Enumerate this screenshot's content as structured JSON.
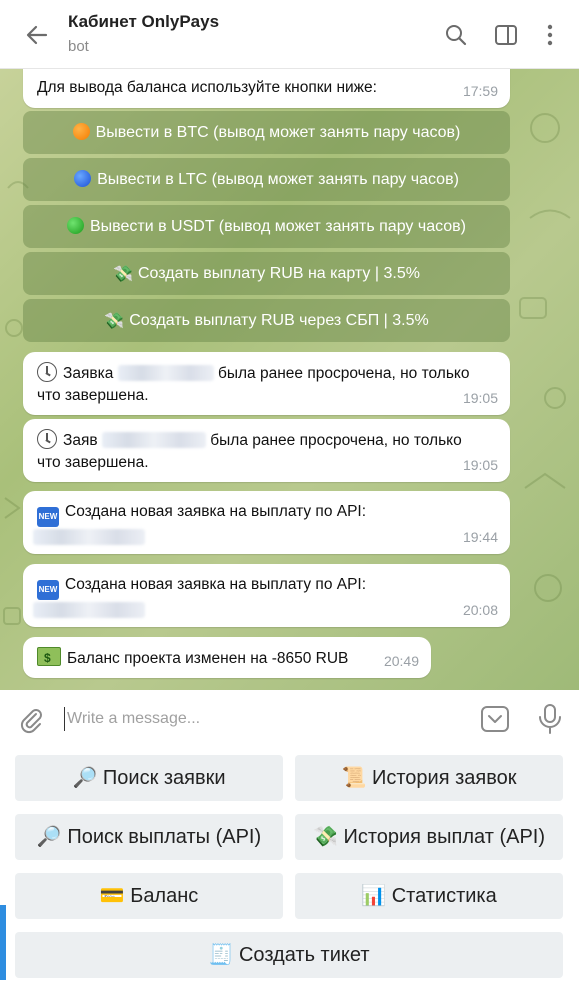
{
  "header": {
    "title": "Кабинет OnlyPays",
    "subtitle": "bot"
  },
  "chat": {
    "intro": {
      "text": "Для вывода баланса используйте кнопки ниже:",
      "time": "17:59"
    },
    "inline_buttons": [
      {
        "icon": "orange-circle",
        "label": "Вывести в BTC  (вывод может занять пару часов)"
      },
      {
        "icon": "blue-circle",
        "label": "Вывести в LTC  (вывод может занять пару часов)"
      },
      {
        "icon": "green-circle",
        "label": "Вывести в USDT  (вывод может занять пару часов)"
      },
      {
        "icon": "money-wings",
        "label": "Создать выплату RUB на карту | 3.5%"
      },
      {
        "icon": "money-wings",
        "label": "Создать выплату RUB через СБП | 3.5%"
      }
    ],
    "messages": [
      {
        "icon": "clock",
        "pre": "Заявка",
        "post": "была ранее просрочена, но только",
        "line2": "что завершена.",
        "time": "19:05"
      },
      {
        "icon": "clock",
        "pre": "Заяв",
        "post": "была ранее просрочена, но только",
        "line2": "что завершена.",
        "time": "19:05"
      },
      {
        "icon": "new-badge",
        "text": "Создана новая заявка на выплату по API:",
        "time": "19:44"
      },
      {
        "icon": "new-badge",
        "text": "Создана новая заявка на выплату по API:",
        "time": "20:08"
      },
      {
        "icon": "money-bag",
        "text": "Баланс проекта изменен на ",
        "amount": "-8650 RUB",
        "time": "20:49"
      }
    ]
  },
  "composer": {
    "placeholder": "Write a message..."
  },
  "keyboard": [
    {
      "icon": "🔎",
      "label": "Поиск заявки"
    },
    {
      "icon": "📜",
      "label": "История заявок"
    },
    {
      "icon": "🔎",
      "label": "Поиск выплаты (API)"
    },
    {
      "icon": "💸",
      "label": "История выплат (API)"
    },
    {
      "icon": "💳",
      "label": "Баланс"
    },
    {
      "icon": "📊",
      "label": "Статистика"
    },
    {
      "icon": "🧾",
      "label": "Создать тикет"
    }
  ],
  "new_badge_text": "NEW",
  "colors": {
    "accent": "#2e8de0",
    "chat_bg": "#b3c78a",
    "button_bg": "#eceff1"
  }
}
